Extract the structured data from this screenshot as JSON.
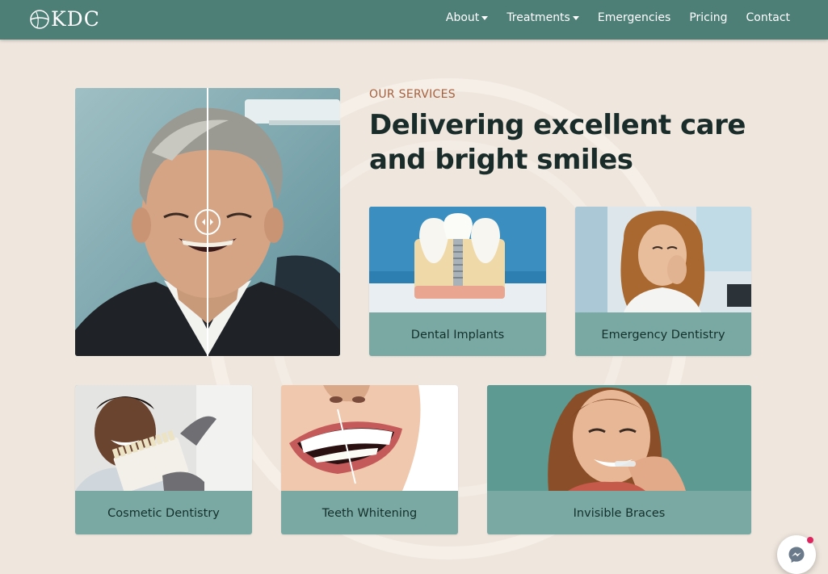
{
  "brand": {
    "name": "KDC"
  },
  "nav": {
    "items": [
      {
        "label": "About",
        "has_dropdown": true
      },
      {
        "label": "Treatments",
        "has_dropdown": true
      },
      {
        "label": "Emergencies",
        "has_dropdown": false
      },
      {
        "label": "Pricing",
        "has_dropdown": false
      },
      {
        "label": "Contact",
        "has_dropdown": false
      }
    ]
  },
  "hero": {
    "eyebrow": "OUR SERVICES",
    "headline_line1": "Delivering excellent care",
    "headline_line2": "and bright smiles",
    "compare_handle_icon": "left-right-arrows-icon"
  },
  "services": [
    {
      "label": "Dental Implants"
    },
    {
      "label": "Emergency Dentistry"
    },
    {
      "label": "Cosmetic Dentistry"
    },
    {
      "label": "Teeth Whitening"
    },
    {
      "label": "Invisible Braces"
    }
  ],
  "chat": {
    "icon": "messenger-icon",
    "has_notification": true
  },
  "colors": {
    "nav_bg": "#4d7f77",
    "page_bg": "#efe7de",
    "card_bg": "#7aa9a4",
    "accent": "#a65f3d",
    "heading": "#1a2c2a"
  }
}
